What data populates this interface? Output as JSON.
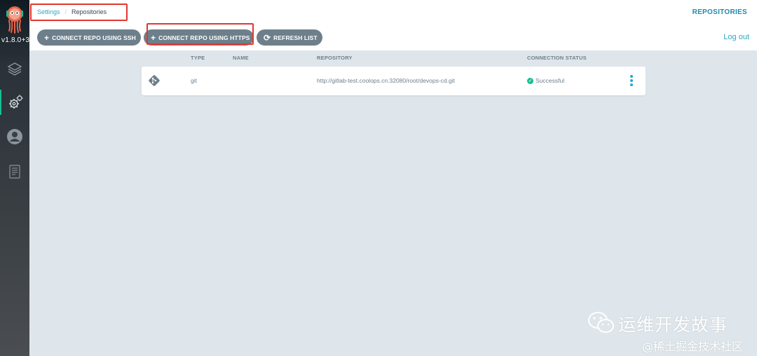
{
  "sidebar": {
    "version": "v1.8.0+3",
    "items": [
      {
        "icon": "layers-icon"
      },
      {
        "icon": "gear-icon"
      },
      {
        "icon": "user-icon"
      },
      {
        "icon": "docs-icon"
      }
    ]
  },
  "breadcrumb": {
    "parent": "Settings",
    "current": "Repositories"
  },
  "header": {
    "title": "REPOSITORIES",
    "logout": "Log out"
  },
  "toolbar": {
    "connect_ssh": "CONNECT REPO USING SSH",
    "connect_https": "CONNECT REPO USING HTTPS",
    "refresh": "REFRESH LIST"
  },
  "table": {
    "columns": [
      "TYPE",
      "NAME",
      "REPOSITORY",
      "CONNECTION STATUS"
    ],
    "rows": [
      {
        "type": "git",
        "name": "",
        "repository": "http://gitlab-test.coolops.cn:32080/root/devops-cd.git",
        "status": "Successful"
      }
    ]
  },
  "watermark": {
    "main": "运维开发故事",
    "sub": "@稀土掘金技术社区"
  },
  "colors": {
    "accent": "#2aa7c9",
    "button": "#6d7f8b",
    "success": "#18be94",
    "highlight": "#e2372e",
    "background": "#dee6eb"
  }
}
